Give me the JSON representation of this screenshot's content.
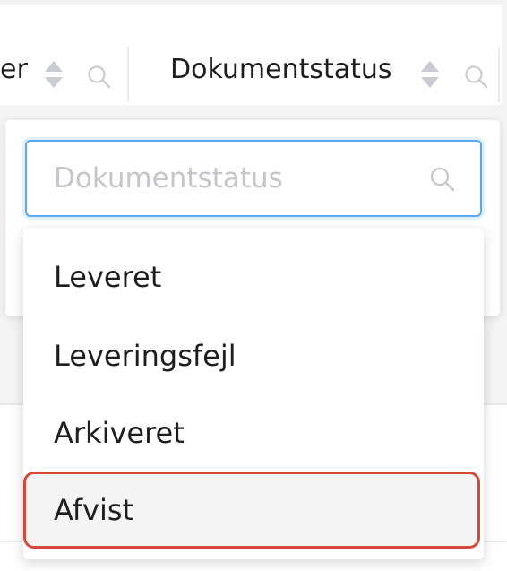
{
  "table_header": {
    "partial_column_label": "er",
    "column_title": "Dokumentstatus"
  },
  "filter": {
    "search_placeholder": "Dokumentstatus",
    "search_value": "",
    "options": [
      {
        "label": "Leveret"
      },
      {
        "label": "Leveringsfejl"
      },
      {
        "label": "Arkiveret"
      },
      {
        "label": "Afvist"
      }
    ],
    "highlighted_option": "Afvist"
  },
  "colors": {
    "focus_border": "#5aa8f0",
    "highlight_border": "#d34a3a",
    "icon_gray": "#c9ccd1"
  },
  "icons": {
    "sort": "sort-icon",
    "search": "search-icon"
  }
}
